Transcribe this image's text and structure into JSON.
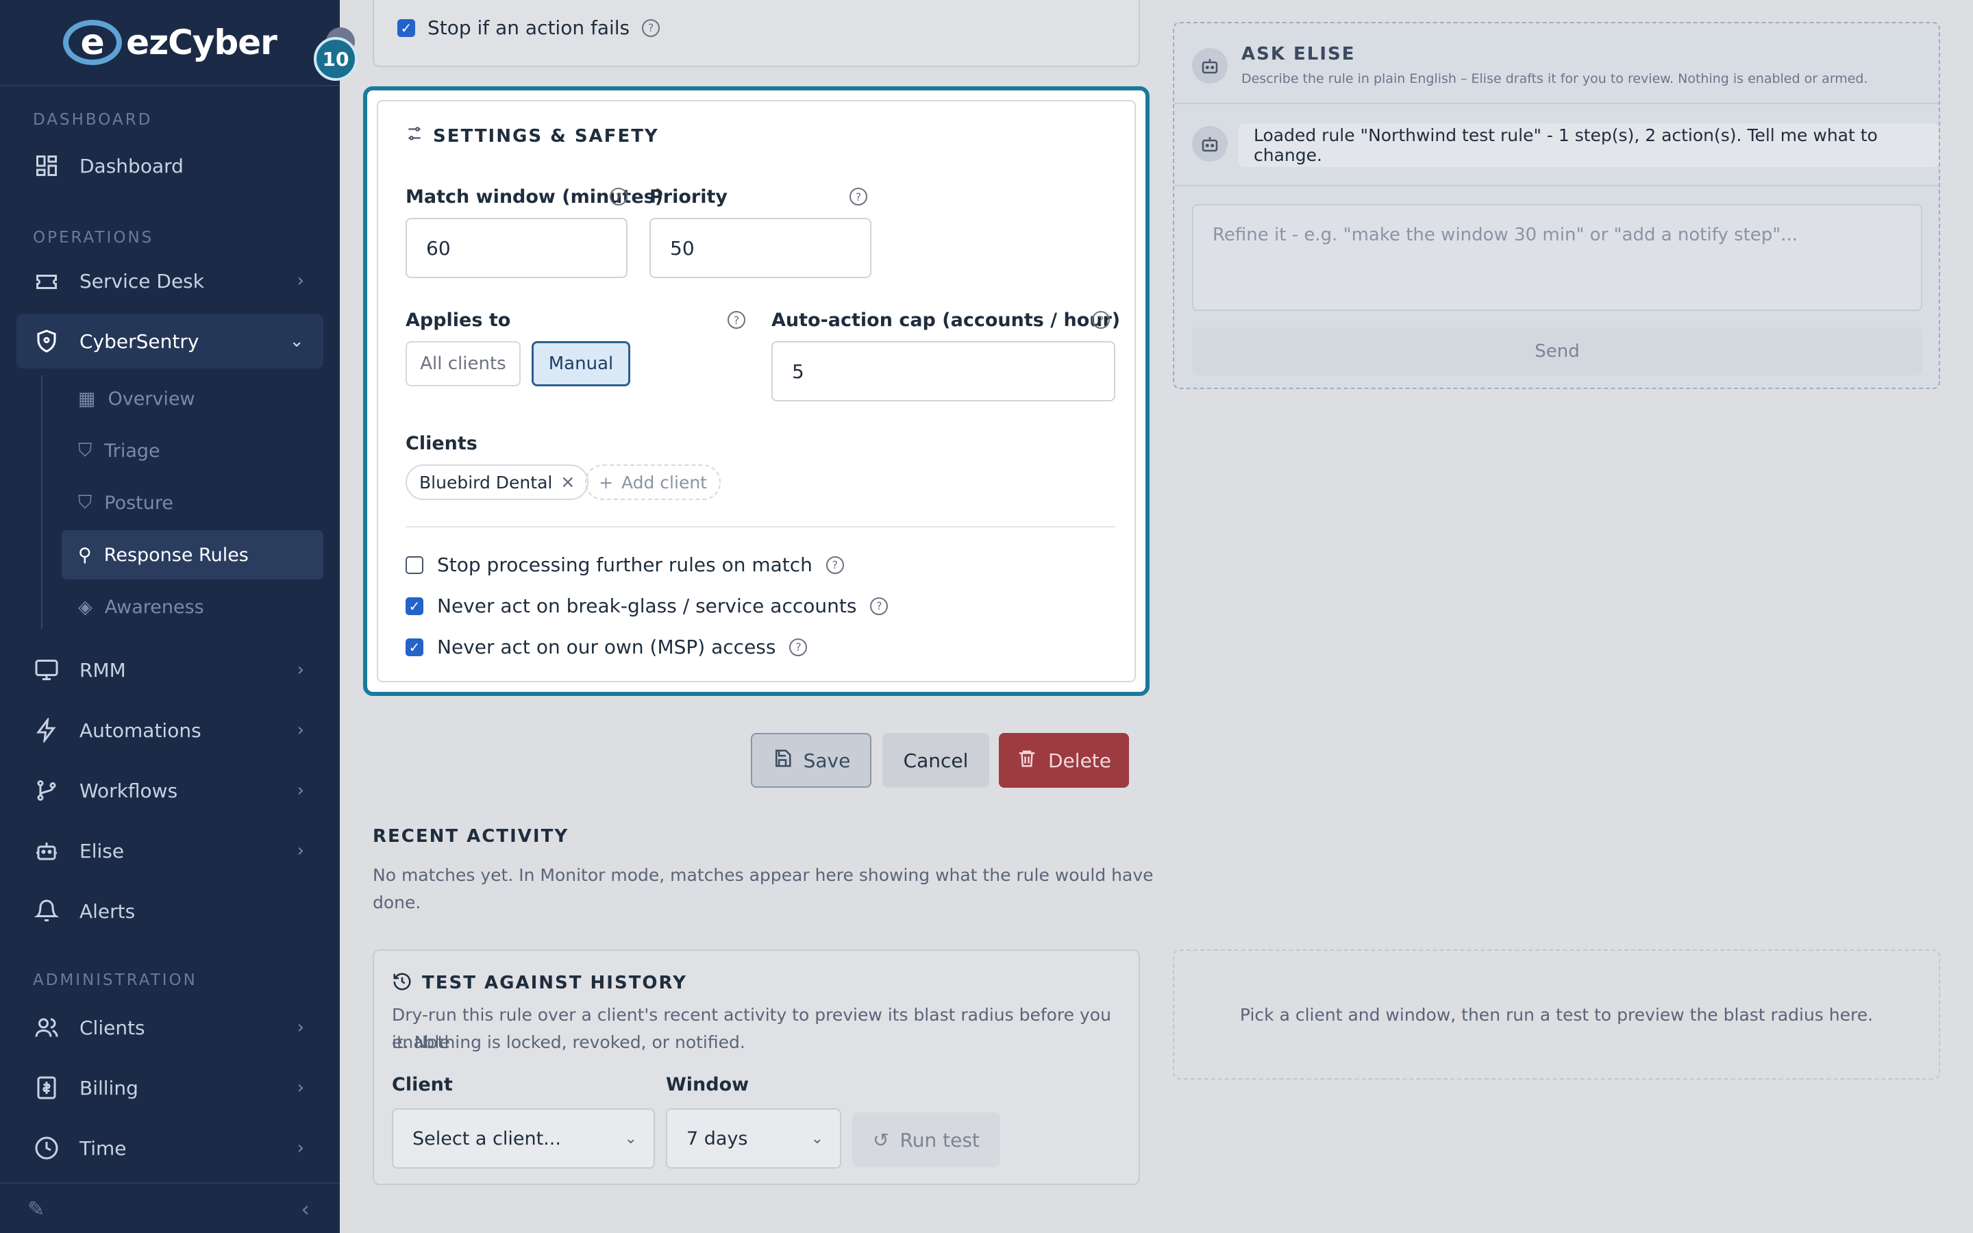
{
  "brand": {
    "name_ez": "ez",
    "name_cyber": "Cyber",
    "badge": "10"
  },
  "sidebar": {
    "sections": {
      "dashboard": "DASHBOARD",
      "operations": "OPERATIONS",
      "administration": "ADMINISTRATION"
    },
    "items": {
      "dashboard": "Dashboard",
      "service_desk": "Service Desk",
      "cybersentry": "CyberSentry",
      "overview": "Overview",
      "triage": "Triage",
      "posture": "Posture",
      "response_rules": "Response Rules",
      "awareness": "Awareness",
      "rmm": "RMM",
      "automations": "Automations",
      "workflows": "Workflows",
      "elise": "Elise",
      "alerts": "Alerts",
      "clients": "Clients",
      "billing": "Billing",
      "time": "Time"
    }
  },
  "top_card": {
    "stop_if_fails": "Stop if an action fails"
  },
  "settings": {
    "title": "SETTINGS & SAFETY",
    "match_window_label": "Match window (minutes)",
    "match_window_value": "60",
    "priority_label": "Priority",
    "priority_value": "50",
    "applies_to_label": "Applies to",
    "applies_all": "All clients",
    "applies_manual": "Manual",
    "cap_label": "Auto-action cap (accounts / hour)",
    "cap_value": "5",
    "clients_label": "Clients",
    "client_chip": "Bluebird Dental",
    "add_client": "Add client",
    "opt_stop_processing": "Stop processing further rules on match",
    "opt_break_glass": "Never act on break-glass / service accounts",
    "opt_msp": "Never act on our own (MSP) access"
  },
  "actions": {
    "save": "Save",
    "cancel": "Cancel",
    "delete": "Delete"
  },
  "recent": {
    "title": "RECENT ACTIVITY",
    "line1": "No matches yet. In Monitor mode, matches appear here showing what the rule would have",
    "line2": "done."
  },
  "test": {
    "title": "TEST AGAINST HISTORY",
    "line1": "Dry-run this rule over a client's recent activity to preview its blast radius before you enable",
    "line2": "it. Nothing is locked, revoked, or notified.",
    "client_label": "Client",
    "client_placeholder": "Select a client...",
    "window_label": "Window",
    "window_value": "7 days",
    "run": "Run test",
    "result_hint": "Pick a client and window, then run a test to preview the blast radius here."
  },
  "elise": {
    "title": "ASK ELISE",
    "subtitle": "Describe the rule in plain English – Elise drafts it for you to review. Nothing is enabled or armed.",
    "message": "Loaded rule \"Northwind test rule\" - 1 step(s), 2 action(s). Tell me what to change.",
    "placeholder": "Refine it - e.g. \"make the window 30 min\" or \"add a notify step\"...",
    "send": "Send"
  },
  "colors": {
    "accent": "#1a7a9c",
    "sidebar": "#1b2a47",
    "danger": "#a23a3f",
    "check": "#2463c9"
  }
}
